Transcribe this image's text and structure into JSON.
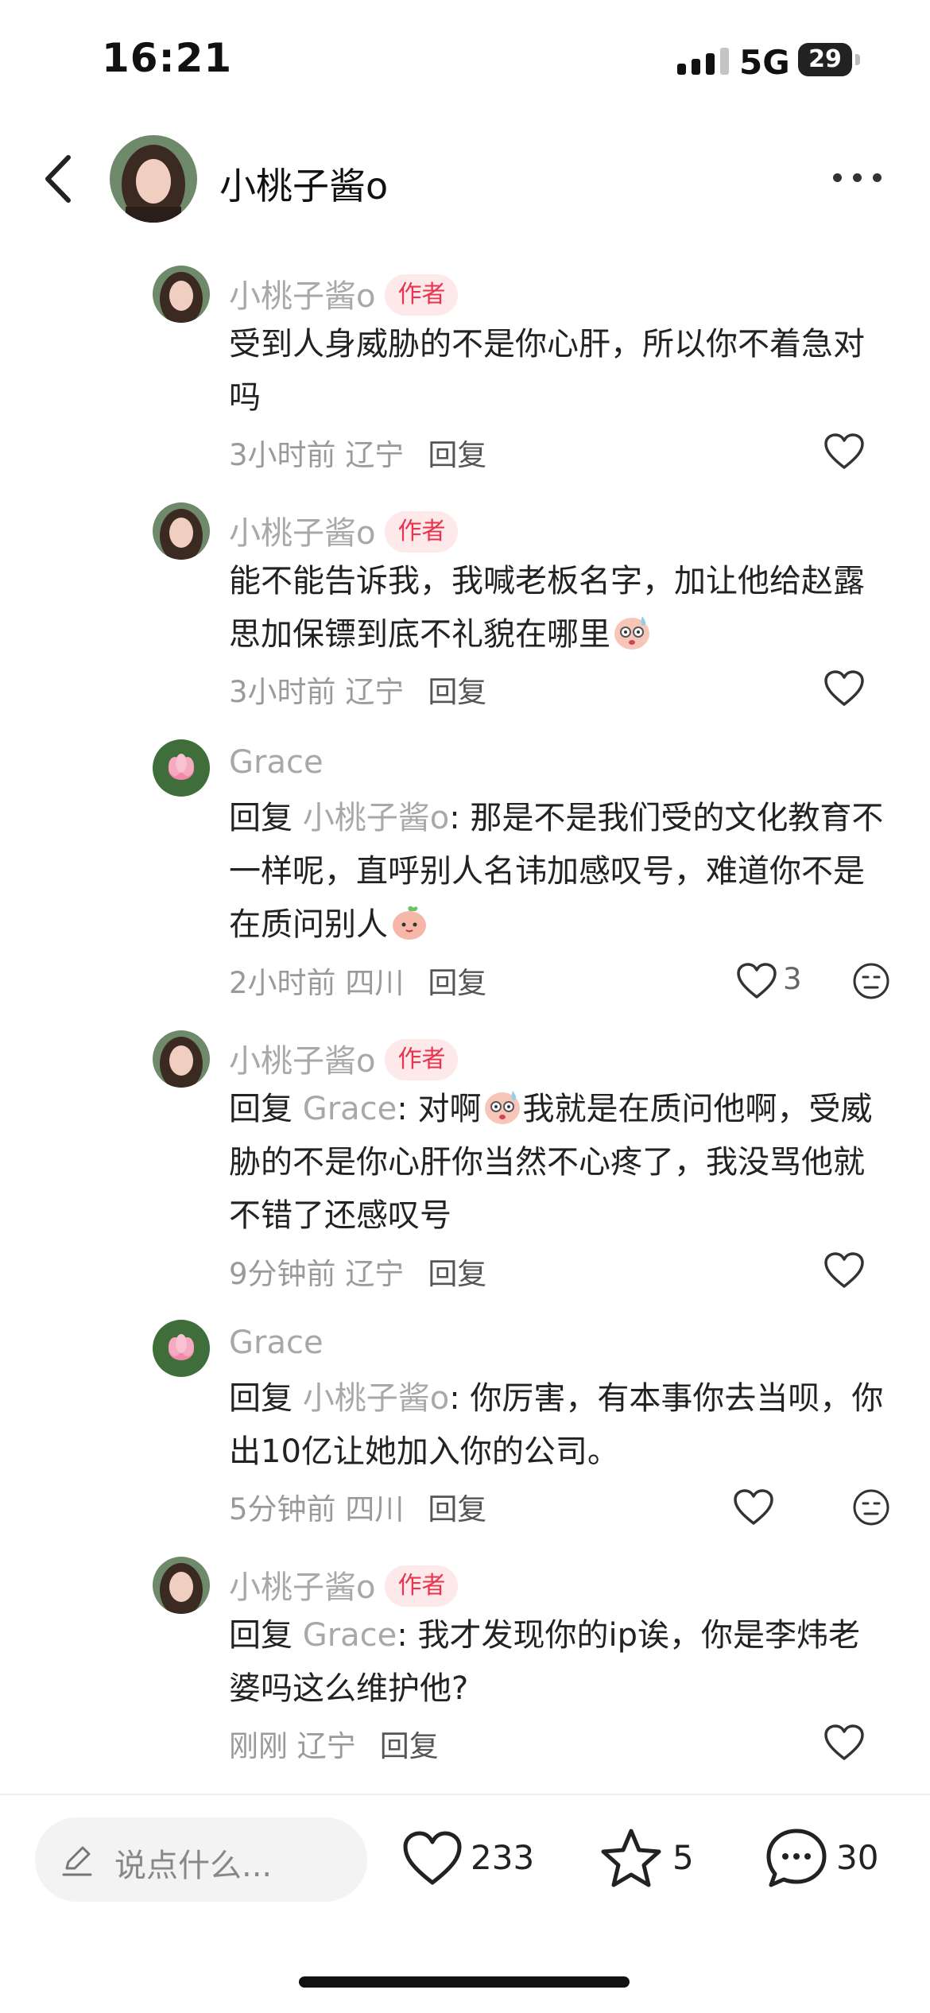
{
  "status_bar": {
    "time": "16:21",
    "network": "5G",
    "battery": "29"
  },
  "header": {
    "title": "小桃子酱o"
  },
  "comments": [
    {
      "author": "小桃子酱o",
      "badge": "作者",
      "text": "受到人身威胁的不是你心肝，所以你不着急对吗",
      "reply_prefix": "",
      "reply_target": "",
      "time": "3小时前",
      "location": "辽宁",
      "reply_label": "回复",
      "likes": ""
    },
    {
      "author": "小桃子酱o",
      "badge": "作者",
      "text": "能不能告诉我，我喊老板名字，加让他给赵露思加保镖到底不礼貌在哪里",
      "reply_prefix": "",
      "reply_target": "",
      "time": "3小时前",
      "location": "辽宁",
      "reply_label": "回复",
      "likes": ""
    },
    {
      "author": "Grace",
      "badge": "",
      "text": ": 那是不是我们受的文化教育不一样呢，直呼别人名讳加感叹号，难道你不是在质问别人",
      "reply_prefix": "回复",
      "reply_target": "小桃子酱o",
      "time": "2小时前",
      "location": "四川",
      "reply_label": "回复",
      "likes": "3"
    },
    {
      "author": "小桃子酱o",
      "badge": "作者",
      "text": ": 对啊",
      "text_after": "我就是在质问他啊，受威胁的不是你心肝你当然不心疼了，我没骂他就不错了还感叹号",
      "reply_prefix": "回复",
      "reply_target": "Grace",
      "time": "9分钟前",
      "location": "辽宁",
      "reply_label": "回复",
      "likes": ""
    },
    {
      "author": "Grace",
      "badge": "",
      "text": ": 你厉害，有本事你去当呗，你出10亿让她加入你的公司。",
      "reply_prefix": "回复",
      "reply_target": "小桃子酱o",
      "time": "5分钟前",
      "location": "四川",
      "reply_label": "回复",
      "likes": ""
    },
    {
      "author": "小桃子酱o",
      "badge": "作者",
      "text": ": 我才发现你的ip诶，你是李炜老婆吗这么维护他?",
      "reply_prefix": "回复",
      "reply_target": "Grace",
      "time": "刚刚",
      "location": "辽宁",
      "reply_label": "回复",
      "likes": ""
    }
  ],
  "bottom_bar": {
    "input_placeholder": "说点什么...",
    "likes": "233",
    "stars": "5",
    "comments": "30"
  },
  "colors": {
    "badge_text": "#e8344e",
    "badge_bg": "#fde8ea",
    "muted": "#a8a8a8"
  }
}
